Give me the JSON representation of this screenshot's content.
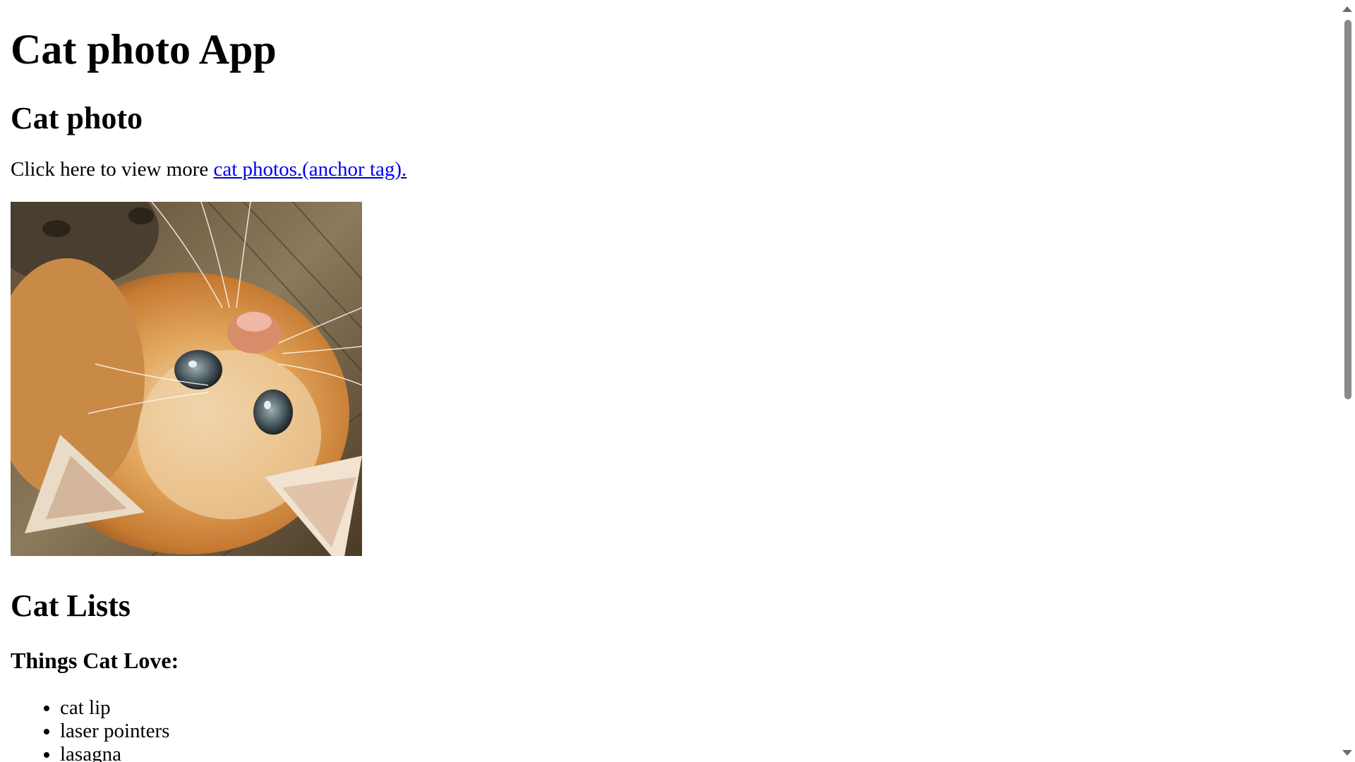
{
  "page": {
    "title": "Cat photo App",
    "photo_heading": "Cat photo",
    "intro_text": "Click here to view more ",
    "link_text": "cat photos.(anchor tag).",
    "photo_alt": "cat photo",
    "lists_heading": "Cat Lists",
    "love_heading": "Things Cat Love:",
    "love_items": [
      "cat lip",
      "laser pointers",
      "lasagna"
    ]
  },
  "icons": {
    "scroll_up": "chevron-up-icon",
    "scroll_down": "chevron-down-icon"
  },
  "colors": {
    "link": "#0000ee",
    "text": "#000000",
    "background": "#ffffff",
    "scrollbar_thumb": "#8a8a8a"
  }
}
